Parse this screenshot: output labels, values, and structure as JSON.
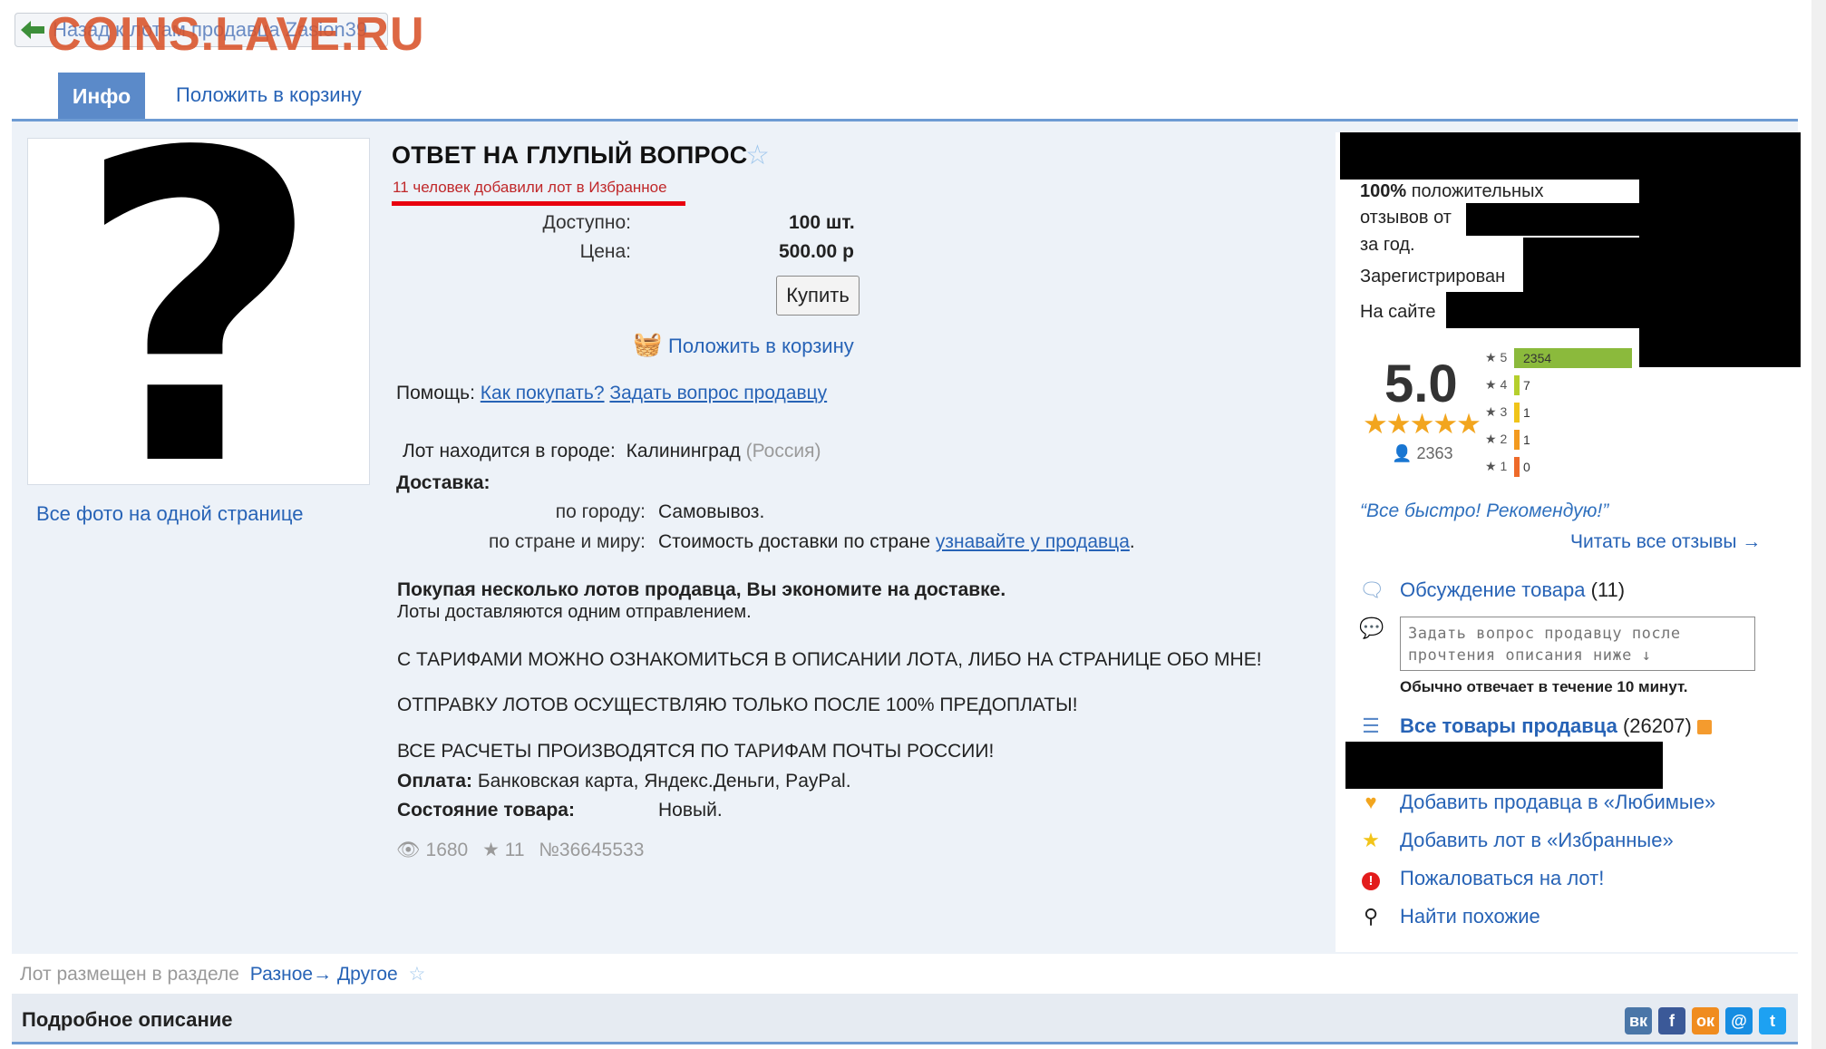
{
  "top": {
    "back_link": "Назад к лотам продавца Zasion39",
    "watermark": "COINS.LAVE.RU"
  },
  "tabs": [
    {
      "label": "Инфо",
      "active": true
    },
    {
      "label": "Положить в корзину",
      "active": false
    }
  ],
  "lot": {
    "title": "ОТВЕТ НА ГЛУПЫЙ ВОПРОС",
    "favorites_note": "11 человек добавили лот в Избранное",
    "available_label": "Доступно:",
    "available_value": "100 шт.",
    "price_label": "Цена:",
    "price_value": "500.00 р",
    "buy_button": "Купить",
    "add_to_cart": "Положить в корзину",
    "help_label": "Помощь:",
    "help_link_1": "Как покупать?",
    "help_link_2": "Задать вопрос продавцу",
    "city_label": "Лот находится в городе:",
    "city_value": "Калининград",
    "country_value": "(Россия)",
    "delivery_label": "Доставка:",
    "delivery_city_label": "по городу:",
    "delivery_city_value": "Самовывоз.",
    "delivery_world_label": "по стране и миру:",
    "delivery_world_value": "Стоимость доставки по стране",
    "delivery_world_link": "узнавайте у продавца",
    "delivery_world_end": ".",
    "saving_bold": "Покупая несколько лотов продавца, Вы экономите на доставке.",
    "saving_note": "Лоты доставляются одним отправлением.",
    "notice_1": "С ТАРИФАМИ МОЖНО ОЗНАКОМИТЬСЯ В ОПИСАНИИ ЛОТА, ЛИБО НА СТРАНИЦЕ ОБО МНЕ!",
    "notice_2": "ОТПРАВКУ ЛОТОВ ОСУЩЕСТВЛЯЮ ТОЛЬКО ПОСЛЕ 100% ПРЕДОПЛАТЫ!",
    "notice_3": "ВСЕ РАСЧЕТЫ ПРОИЗВОДЯТСЯ ПО ТАРИФАМ ПОЧТЫ РОССИИ!",
    "payment_label": "Оплата:",
    "payment_value": "Банковская карта, Яндекс.Деньги, PayPal.",
    "condition_label": "Состояние товара:",
    "condition_value": "Новый.",
    "views": "1680",
    "favs": "11",
    "lot_number": "№36645533"
  },
  "photo": {
    "all_photos_link": "Все фото на одной странице",
    "placeholder_glyph": "?"
  },
  "seller": {
    "positive_pct": "100%",
    "positive_text": "положительных",
    "reviews_from": "отзывов от",
    "per_year": "за год.",
    "registered": "Зарегистрирован",
    "on_site": "На сайте",
    "rating": "5.0",
    "stars": "★★★★★",
    "votes": "2363",
    "distribution": [
      {
        "stars": "5",
        "count": "2354",
        "fraction": 1.0,
        "color": "#8bba3c"
      },
      {
        "stars": "4",
        "count": "7",
        "fraction": 0.003,
        "color": "#b5cf2d"
      },
      {
        "stars": "3",
        "count": "1",
        "fraction": 0.001,
        "color": "#f0c419"
      },
      {
        "stars": "2",
        "count": "1",
        "fraction": 0.001,
        "color": "#f39a1f"
      },
      {
        "stars": "1",
        "count": "0",
        "fraction": 0.0,
        "color": "#ee6a2a"
      }
    ],
    "quote": "“Все быстро! Рекомендую!”",
    "read_all": "Читать все отзывы →",
    "discussion_label": "Обсуждение товара",
    "discussion_count": "(11)",
    "ask_placeholder": "Задать вопрос продавцу после прочтения описания ниже ↓",
    "reply_time": "Обычно отвечает в течение 10 минут.",
    "all_items_label": "Все товары продавца",
    "all_items_count": "(26207)",
    "add_seller_fav": "Добавить продавца в «Любимые»",
    "add_lot_fav": "Добавить лот в «Избранные»",
    "complain": "Пожаловаться на лот!",
    "find_similar": "Найти похожие"
  },
  "category": {
    "label": "Лот размещен в разделе",
    "path_1": "Разное",
    "arrow": "→",
    "path_2": "Другое"
  },
  "footer": {
    "title": "Подробное описание",
    "social": [
      {
        "name": "vk-icon",
        "glyph": "вк",
        "color": "#4a76a8"
      },
      {
        "name": "facebook-icon",
        "glyph": "f",
        "color": "#3b5998"
      },
      {
        "name": "odnoklassniki-icon",
        "glyph": "ок",
        "color": "#f08c1f"
      },
      {
        "name": "mailru-icon",
        "glyph": "@",
        "color": "#168de2"
      },
      {
        "name": "twitter-icon",
        "glyph": "t",
        "color": "#1da1f2"
      }
    ]
  }
}
